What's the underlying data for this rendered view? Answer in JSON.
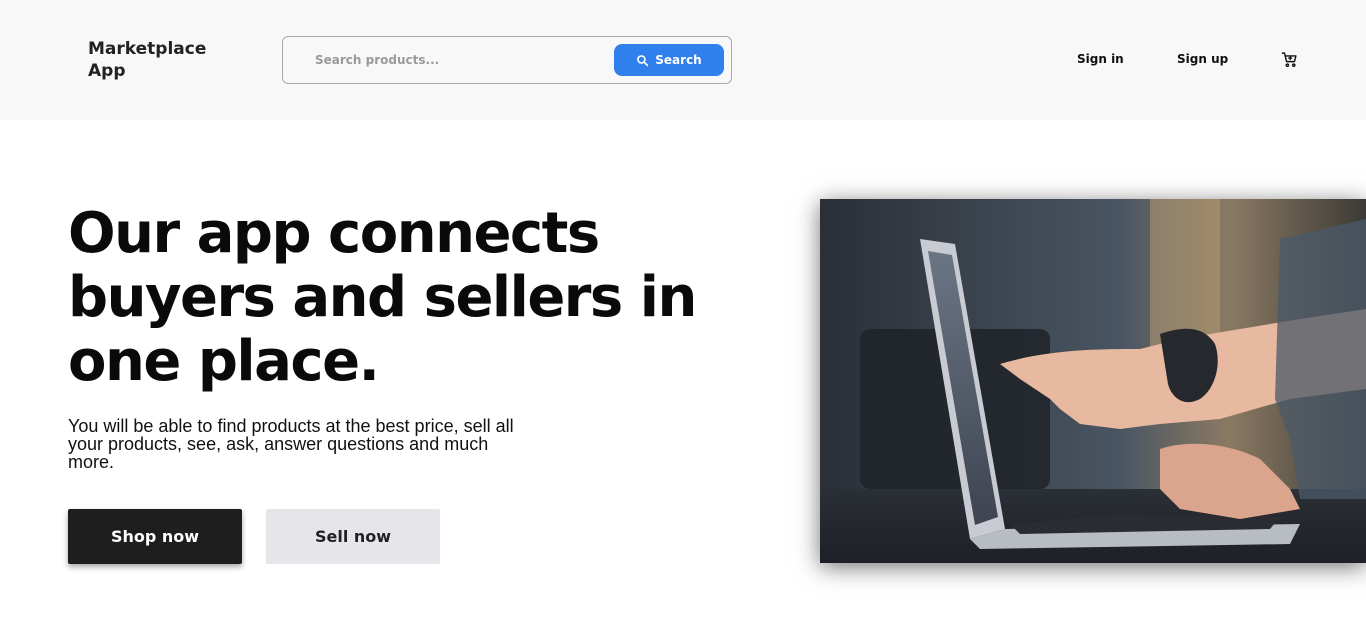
{
  "header": {
    "logo": "Marketplace App",
    "search": {
      "placeholder": "Search products...",
      "value": "",
      "button_label": "Search"
    },
    "nav": {
      "signin_label": "Sign in",
      "signup_label": "Sign up"
    },
    "icons": {
      "search": "search-icon",
      "cart": "cart-icon"
    }
  },
  "hero": {
    "title": "Our app connects buyers and sellers in one place.",
    "subtitle": "You will be able to find products at the best price, sell all your products, see, ask, answer questions and much more.",
    "primary_cta": "Shop now",
    "secondary_cta": "Sell now"
  },
  "colors": {
    "accent": "#2f80ed",
    "header_bg": "#f8f8f8",
    "primary_button": "#1e1e1e",
    "secondary_button": "#e6e6ea"
  }
}
